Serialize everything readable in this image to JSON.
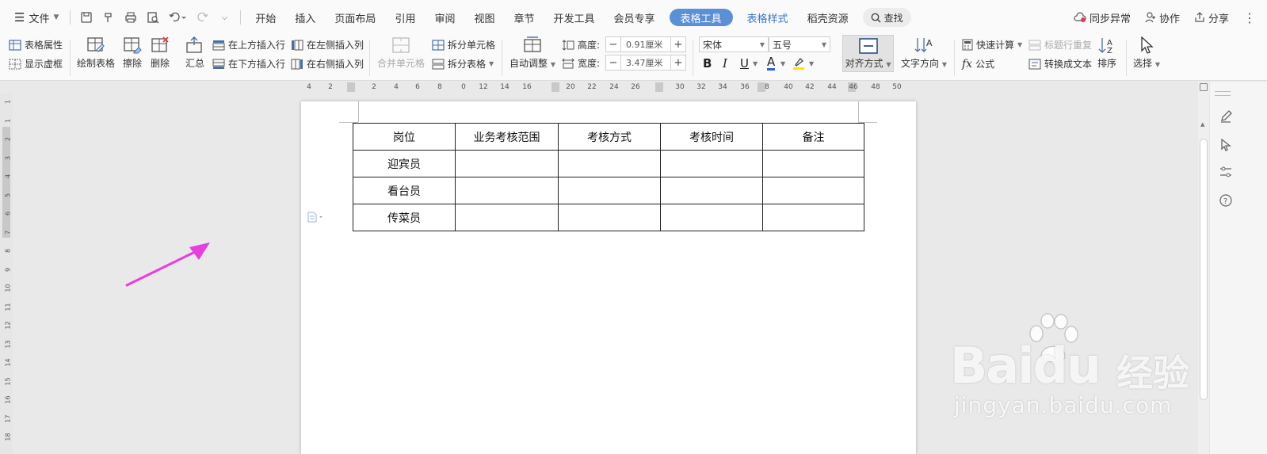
{
  "menubar": {
    "file_label": "文件",
    "tabs": [
      "开始",
      "插入",
      "页面布局",
      "引用",
      "审阅",
      "视图",
      "章节",
      "开发工具",
      "会员专享"
    ],
    "active_tab": "表格工具",
    "extra_tabs": [
      "表格样式",
      "稻壳资源"
    ],
    "search_label": "查找",
    "sync_label": "同步异常",
    "collab_label": "协作",
    "share_label": "分享"
  },
  "ribbon": {
    "table_props": "表格属性",
    "show_gridlines": "显示虚框",
    "draw_table": "绘制表格",
    "erase": "擦除",
    "delete": "删除",
    "summary": "汇总",
    "insert_row_above": "在上方插入行",
    "insert_row_below": "在下方插入行",
    "insert_col_left": "在左侧插入列",
    "insert_col_right": "在右侧插入列",
    "merge_cells": "合并单元格",
    "split_cells": "拆分单元格",
    "split_table": "拆分表格",
    "auto_fit": "自动调整",
    "height_label": "高度:",
    "height_value": "0.91厘米",
    "width_label": "宽度:",
    "width_value": "3.47厘米",
    "font_name": "宋体",
    "font_size": "五号",
    "bold": "B",
    "italic": "I",
    "underline": "U",
    "font_color": "A",
    "align": "对齐方式",
    "text_direction": "文字方向",
    "quick_calc": "快速计算",
    "repeat_header": "标题行重复",
    "formula": "公式",
    "to_text": "转换成文本",
    "sort": "排序",
    "select": "选择"
  },
  "ruler": {
    "h_ticks": [
      "4",
      "2",
      "2",
      "4",
      "6",
      "8",
      "0",
      "12",
      "14",
      "16",
      "20",
      "22",
      "24",
      "26",
      "30",
      "32",
      "34",
      "36",
      "8",
      "40",
      "42",
      "44",
      "46",
      "48",
      "50"
    ],
    "v_ticks": [
      "1",
      "1",
      "2",
      "3",
      "4",
      "5",
      "6",
      "7",
      "8",
      "9",
      "10",
      "11",
      "12",
      "13",
      "14",
      "15",
      "16",
      "17",
      "18"
    ]
  },
  "table": {
    "header": [
      "岗位",
      "业务考核范围",
      "考核方式",
      "考核时间",
      "备注"
    ],
    "rows": [
      [
        "迎宾员",
        "",
        "",
        "",
        ""
      ],
      [
        "看台员",
        "",
        "",
        "",
        ""
      ],
      [
        "传菜员",
        "",
        "",
        "",
        ""
      ]
    ]
  },
  "colors": {
    "accent": "#5b8fd6",
    "arrow": "#e83de0"
  },
  "watermark": {
    "brand": "Baidu",
    "brand_cn": "经验",
    "url": "jingyan.baidu.com"
  }
}
